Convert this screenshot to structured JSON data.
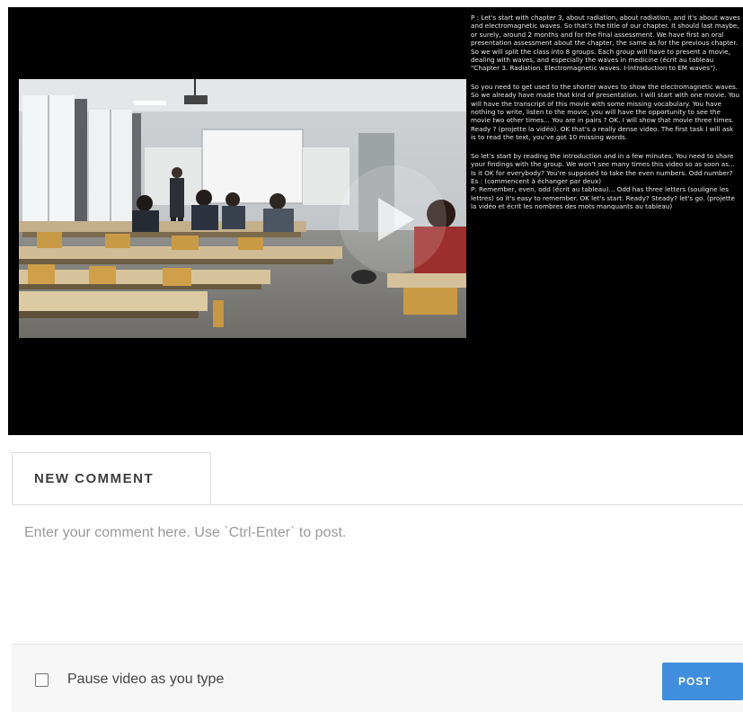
{
  "video": {
    "play_icon": "play-icon",
    "transcript": [
      "P : Let's start with chapter 3, about radiation, about radiation, and it's about waves and electromagnetic waves. So that's the title of our chapter. It should last maybe, or surely, around 2 months and for the final assessment. We have first an oral presentation assessment about the chapter, the same as for the previous chapter. So we will split the class into 8 groups. Each group will have to present a movie, dealing with waves, and especially the waves in medicine (écrit au tableau \"Chapter 3. Radiation. Electromagnetic waves. I-Introduction to EM waves\").",
      "So you need to get used to the shorter waves to show the electromagnetic waves. So we already have made that kind of presentation. I will start with one movie. You will have the transcript of this movie with some missing vocabulary. You have nothing to write, listen to the movie, you will have the opportunity to see the movie two other times... You are in pairs ? OK. I will show that movie three times. Ready ? (projette la vidéo). OK that's a really dense video. The first task I will ask is to read the text, you've got 10 missing words.",
      "So let's start by reading the introduction and in a few minutes. You need to share your findings with the group. We won't see many times this video so as soon as... Is it OK for everybody? You're supposed to take the even numbers. Odd number?\nEs : (commencent à échanger par deux)\nP: Remember, even, odd (écrit au tableau)... Odd has three letters (souligne les lettres) so it's easy to remember. OK let's start. Ready? Steady? let's go. (projette la vidéo et écrit les nombres des mots manquants au tableau)"
    ]
  },
  "comment": {
    "tab_label": "NEW COMMENT",
    "placeholder": "Enter your comment here. Use `Ctrl-Enter` to post.",
    "value": "",
    "pause_label": "Pause video as you type",
    "pause_checked": false,
    "post_label": "POST"
  },
  "colors": {
    "accent": "#3f8fdd",
    "player_background": "#000000",
    "footer_background": "#f7f7f7"
  }
}
